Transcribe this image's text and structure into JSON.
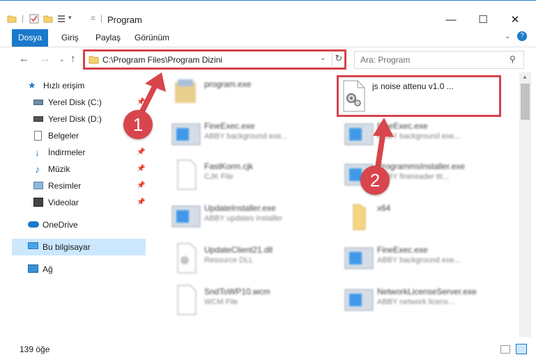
{
  "window": {
    "title": "Program"
  },
  "ribbon": {
    "tabs": [
      "Dosya",
      "Giriş",
      "Paylaş",
      "Görünüm"
    ]
  },
  "address": {
    "path": "C:\\Program Files\\Program Dizini"
  },
  "search": {
    "placeholder": "Ara: Program"
  },
  "navigation": {
    "items": [
      {
        "label": "Hızlı erişim",
        "icon": "star-icon",
        "pinned": false
      },
      {
        "label": "Yerel Disk (C:)",
        "icon": "drive-icon",
        "pinned": true
      },
      {
        "label": "Yerel Disk (D:)",
        "icon": "drive-icon",
        "pinned": true
      },
      {
        "label": "Belgeler",
        "icon": "documents-icon",
        "pinned": true
      },
      {
        "label": "İndirmeler",
        "icon": "download-icon",
        "pinned": true
      },
      {
        "label": "Müzik",
        "icon": "music-icon",
        "pinned": true
      },
      {
        "label": "Resimler",
        "icon": "pictures-icon",
        "pinned": true
      },
      {
        "label": "Videolar",
        "icon": "video-icon",
        "pinned": true
      },
      {
        "label": "OneDrive",
        "icon": "cloud-icon",
        "pinned": false
      },
      {
        "label": "Bu bilgisayar",
        "icon": "computer-icon",
        "pinned": false,
        "selected": true
      },
      {
        "label": "Ağ",
        "icon": "network-icon",
        "pinned": false
      }
    ]
  },
  "files": [
    {
      "name": "program.exe",
      "desc": "",
      "icon": "setup-icon"
    },
    {
      "name": "js noise attenu v1.0 ...",
      "desc": "",
      "icon": "dll-gear-icon",
      "highlighted": true
    },
    {
      "name": "FineExec.exe",
      "desc": "ABBY background exe...",
      "icon": "app-window-icon"
    },
    {
      "name": "FineExec.exe",
      "desc": "ABBY background exe...",
      "icon": "app-window-icon"
    },
    {
      "name": "FastKorm.cjk",
      "desc": "CJK File",
      "icon": "blank-file-icon"
    },
    {
      "name": "ProgrammsInstaller.exe",
      "desc": "ABBY finereader ttr...",
      "icon": "app-window-icon"
    },
    {
      "name": "UpdateInstaller.exe",
      "desc": "ABBY updates installer",
      "icon": "app-window-icon"
    },
    {
      "name": "x64",
      "desc": "",
      "icon": "folder-icon"
    },
    {
      "name": "UpdateClient21.dll",
      "desc": "Resource DLL",
      "icon": "dll-gear-icon"
    },
    {
      "name": "FineExec.exe",
      "desc": "ABBY background exe...",
      "icon": "app-window-icon"
    },
    {
      "name": "SndToWP10.wcm",
      "desc": "WCM File",
      "icon": "blank-file-icon"
    },
    {
      "name": "NetworkLicenseServer.exe",
      "desc": "ABBY network licens...",
      "icon": "app-window-icon"
    }
  ],
  "callouts": {
    "one": "1",
    "two": "2"
  },
  "status": {
    "count": "139 öğe"
  },
  "colors": {
    "accent": "#1979ca",
    "highlight": "#d6434c",
    "selected": "#cce8ff"
  }
}
